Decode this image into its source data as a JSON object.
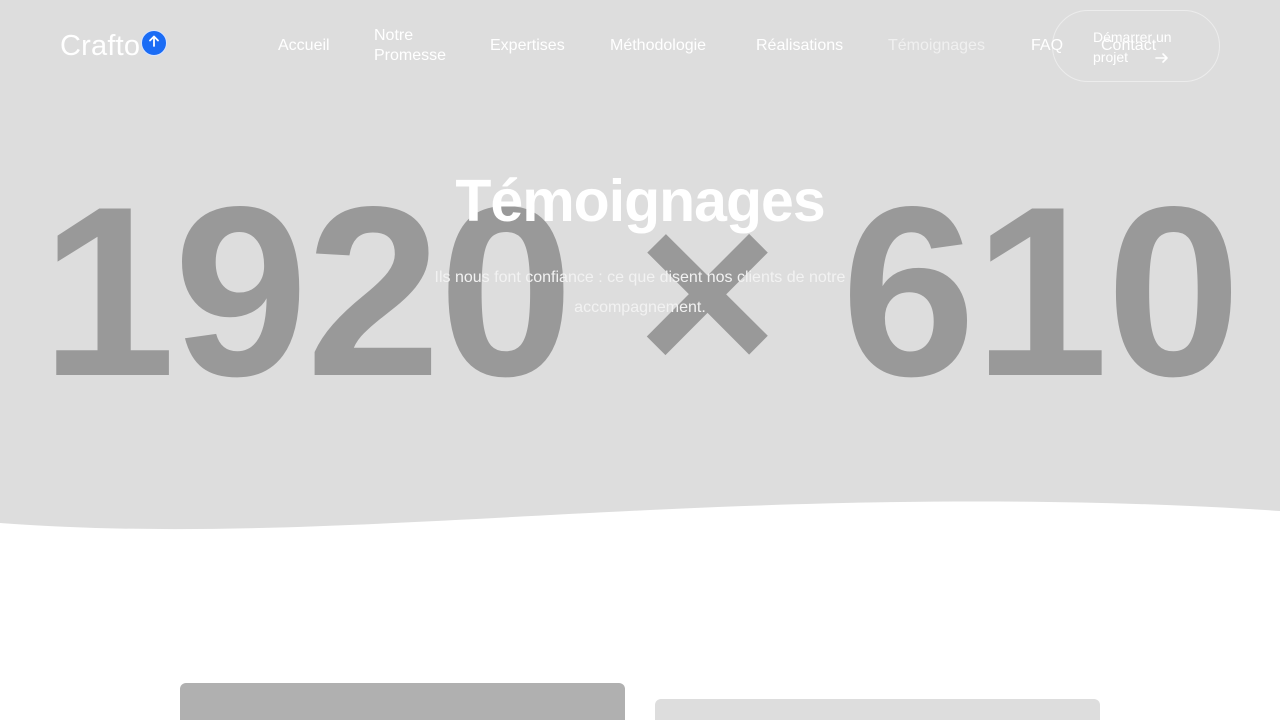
{
  "header": {
    "logo_text": "Crafto",
    "scroll_top_icon": "arrow-up-icon",
    "nav": [
      {
        "label": "Accueil"
      },
      {
        "label": "Notre Promesse"
      },
      {
        "label": "Expertises"
      },
      {
        "label": "Méthodologie"
      },
      {
        "label": "Réalisations"
      },
      {
        "label": "Témoignages",
        "active": true
      },
      {
        "label": "FAQ"
      },
      {
        "label": "Contact"
      }
    ],
    "cta_label": "Démarrer un projet",
    "cta_icon": "arrow-right-icon"
  },
  "hero": {
    "placeholder_label": "1920 × 610",
    "title": "Témoignages",
    "subtitle": "Ils nous font confiance : ce que disent nos clients de notre accompagnement."
  },
  "colors": {
    "hero_bg": "#dddddd",
    "placeholder_text": "#999999",
    "accent": "#1a6cf5",
    "card_1": "#b0b0b0",
    "card_2": "#dddddd"
  }
}
